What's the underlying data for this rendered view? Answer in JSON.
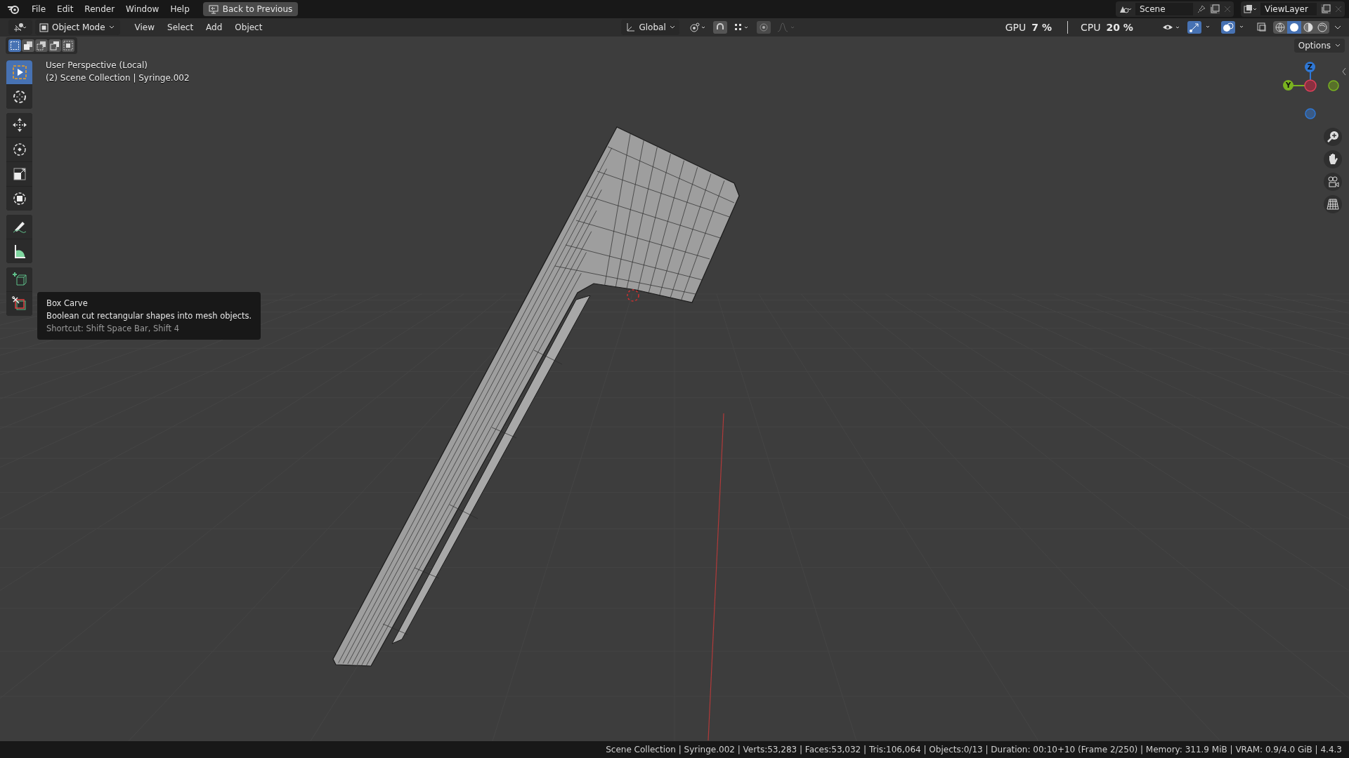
{
  "top_bar": {
    "menus": [
      "File",
      "Edit",
      "Render",
      "Window",
      "Help"
    ],
    "back_button": "Back to Previous",
    "scene": "Scene",
    "view_layer": "ViewLayer"
  },
  "header": {
    "mode": "Object Mode",
    "menus": [
      "View",
      "Select",
      "Add",
      "Object"
    ],
    "orientation": "Global",
    "options": "Options"
  },
  "stats": [
    {
      "label": "GPU",
      "value": "7 %"
    },
    {
      "label": "CPU",
      "value": "20 %"
    }
  ],
  "select_modes": [
    {
      "kind": "new",
      "selected": true
    },
    {
      "kind": "extend",
      "selected": false
    },
    {
      "kind": "subtract",
      "selected": false
    },
    {
      "kind": "invert",
      "selected": false
    },
    {
      "kind": "intersect",
      "selected": false
    }
  ],
  "shading": [
    {
      "kind": "wireframe",
      "selected": false
    },
    {
      "kind": "solid",
      "selected": true
    },
    {
      "kind": "material",
      "selected": false
    },
    {
      "kind": "rendered",
      "selected": false
    }
  ],
  "viewport": {
    "lines": [
      "User Perspective (Local)",
      "(2) Scene Collection | Syringe.002"
    ]
  },
  "tools": [
    {
      "kind": "select",
      "selected": true
    },
    {
      "kind": "cursor",
      "selected": false
    },
    {
      "kind": "move",
      "selected": false
    },
    {
      "kind": "rotate",
      "selected": false
    },
    {
      "kind": "scale",
      "selected": false
    },
    {
      "kind": "transform",
      "selected": false
    },
    {
      "kind": "annotate",
      "selected": false
    },
    {
      "kind": "measure",
      "selected": false
    },
    {
      "kind": "add_cube",
      "selected": false
    },
    {
      "kind": "box_carve",
      "selected": false
    }
  ],
  "tooltip": {
    "title": "Box Carve",
    "description": "Boolean cut rectangular shapes into mesh objects.",
    "shortcut": "Shortcut: Shift Space Bar, Shift 4"
  },
  "gizmo": {
    "axes": [
      {
        "label": "Z",
        "color": "#2f78d6"
      },
      {
        "label": "Y",
        "color": "#7ab320"
      }
    ]
  },
  "status_bar": "Scene Collection | Syringe.002 | Verts:53,283 | Faces:53,032 | Tris:106,064 | Objects:0/13 | Duration: 00:10+10 (Frame 2/250) | Memory: 311.9 MiB | VRAM: 0.9/4.0 GiB | 4.4.3"
}
